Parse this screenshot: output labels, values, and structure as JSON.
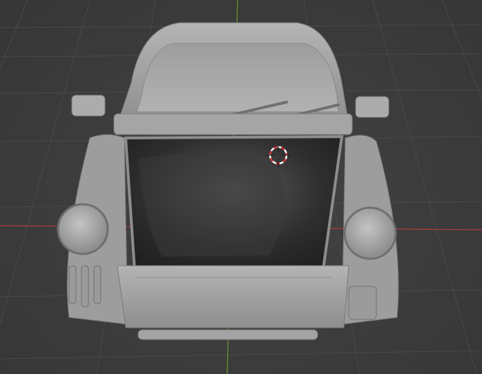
{
  "app": {
    "name": "3D viewport",
    "mode": "solid-shading"
  },
  "viewport": {
    "background_color": "#3d3d3d",
    "grid_color": "#4a4a4a",
    "x_axis_color": "#b23a3a",
    "y_axis_color": "#6a9a2a",
    "model_color": "#a9a9a9"
  },
  "icons": {
    "cursor": "3d-cursor-icon"
  }
}
